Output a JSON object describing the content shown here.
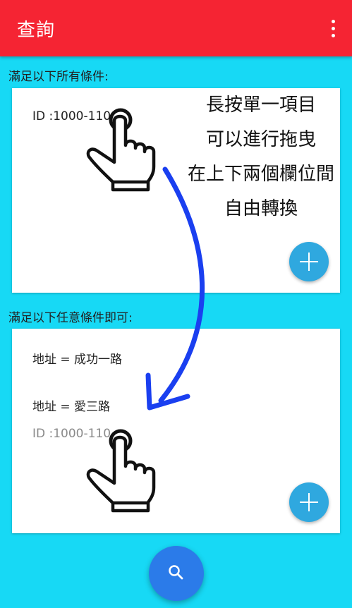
{
  "app_bar": {
    "title": "查詢",
    "menu_icon": "more-vert-icon"
  },
  "section_all": {
    "label": "滿足以下所有條件:",
    "items": [
      "ID :1000-110"
    ]
  },
  "section_any": {
    "label": "滿足以下任意條件即可:",
    "items": [
      "地址 = 成功一路",
      "地址 = 愛三路",
      "ID :1000-110"
    ]
  },
  "instruction": {
    "lines": [
      "長按單一項目",
      "可以進行拖曳",
      "在上下兩個欄位間",
      "自由轉換"
    ]
  },
  "colors": {
    "app_bar": "#f52433",
    "background": "#17d9f5",
    "fab_small": "#2fa8df",
    "fab_main": "#2b7be9",
    "arrow": "#1a3ff0"
  }
}
